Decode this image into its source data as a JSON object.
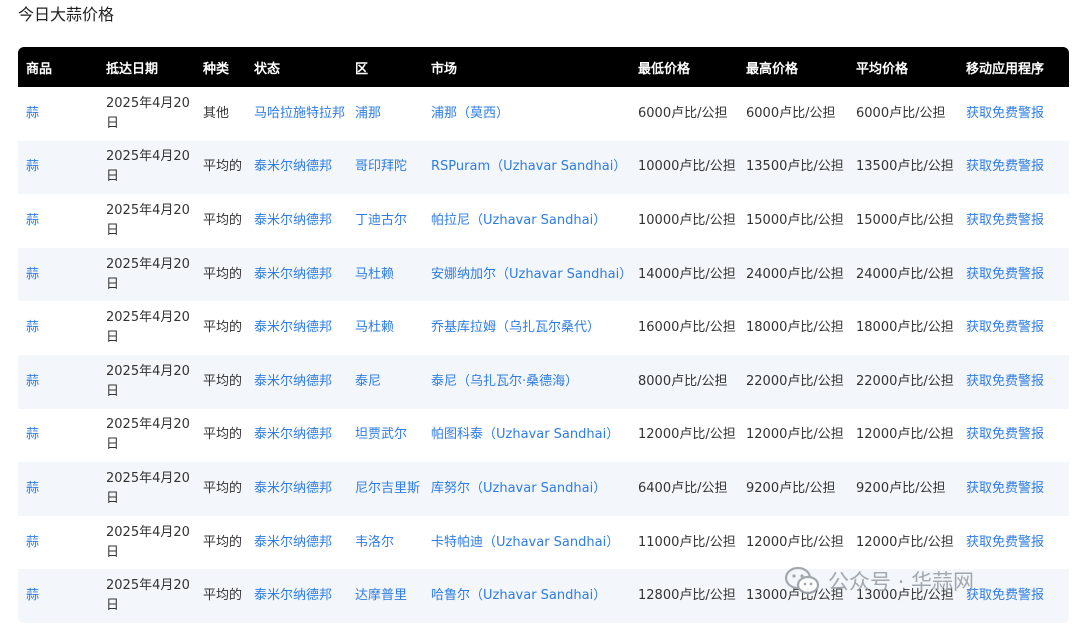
{
  "page": {
    "title": "今日大蒜价格"
  },
  "table": {
    "headers": [
      "商品",
      "抵达日期",
      "种类",
      "状态",
      "区",
      "市场",
      "最低价格",
      "最高价格",
      "平均价格",
      "移动应用程序"
    ],
    "rows": [
      [
        "蒜",
        "2025年4月20日",
        "其他",
        "马哈拉施特拉邦",
        "浦那",
        "浦那（莫西）",
        "6000卢比/公担",
        "6000卢比/公担",
        "6000卢比/公担",
        "获取免费警报"
      ],
      [
        "蒜",
        "2025年4月20日",
        "平均的",
        "泰米尔纳德邦",
        "哥印拜陀",
        "RSPuram（Uzhavar Sandhai）",
        "10000卢比/公担",
        "13500卢比/公担",
        "13500卢比/公担",
        "获取免费警报"
      ],
      [
        "蒜",
        "2025年4月20日",
        "平均的",
        "泰米尔纳德邦",
        "丁迪古尔",
        "帕拉尼（Uzhavar Sandhai）",
        "10000卢比/公担",
        "15000卢比/公担",
        "15000卢比/公担",
        "获取免费警报"
      ],
      [
        "蒜",
        "2025年4月20日",
        "平均的",
        "泰米尔纳德邦",
        "马杜赖",
        "安娜纳加尔（Uzhavar Sandhai）",
        "14000卢比/公担",
        "24000卢比/公担",
        "24000卢比/公担",
        "获取免费警报"
      ],
      [
        "蒜",
        "2025年4月20日",
        "平均的",
        "泰米尔纳德邦",
        "马杜赖",
        "乔基库拉姆（乌扎瓦尔桑代）",
        "16000卢比/公担",
        "18000卢比/公担",
        "18000卢比/公担",
        "获取免费警报"
      ],
      [
        "蒜",
        "2025年4月20日",
        "平均的",
        "泰米尔纳德邦",
        "泰尼",
        "泰尼（乌扎瓦尔·桑德海）",
        "8000卢比/公担",
        "22000卢比/公担",
        "22000卢比/公担",
        "获取免费警报"
      ],
      [
        "蒜",
        "2025年4月20日",
        "平均的",
        "泰米尔纳德邦",
        "坦贾武尔",
        "帕图科泰（Uzhavar Sandhai）",
        "12000卢比/公担",
        "12000卢比/公担",
        "12000卢比/公担",
        "获取免费警报"
      ],
      [
        "蒜",
        "2025年4月20日",
        "平均的",
        "泰米尔纳德邦",
        "尼尔吉里斯",
        "库努尔（Uzhavar Sandhai）",
        "6400卢比/公担",
        "9200卢比/公担",
        "9200卢比/公担",
        "获取免费警报"
      ],
      [
        "蒜",
        "2025年4月20日",
        "平均的",
        "泰米尔纳德邦",
        "韦洛尔",
        "卡特帕迪（Uzhavar Sandhai）",
        "11000卢比/公担",
        "12000卢比/公担",
        "12000卢比/公担",
        "获取免费警报"
      ],
      [
        "蒜",
        "2025年4月20日",
        "平均的",
        "泰米尔纳德邦",
        "达摩普里",
        "哈鲁尔（Uzhavar Sandhai）",
        "12800卢比/公担",
        "13000卢比/公担",
        "13000卢比/公担",
        "获取免费警报"
      ]
    ]
  },
  "watermark": {
    "icon": "wechat-icon",
    "text": "公众号 · 华蒜网"
  },
  "colors": {
    "header_bg": "#000000",
    "link": "#2f7de1",
    "row_alt": "#f3f6fa"
  }
}
